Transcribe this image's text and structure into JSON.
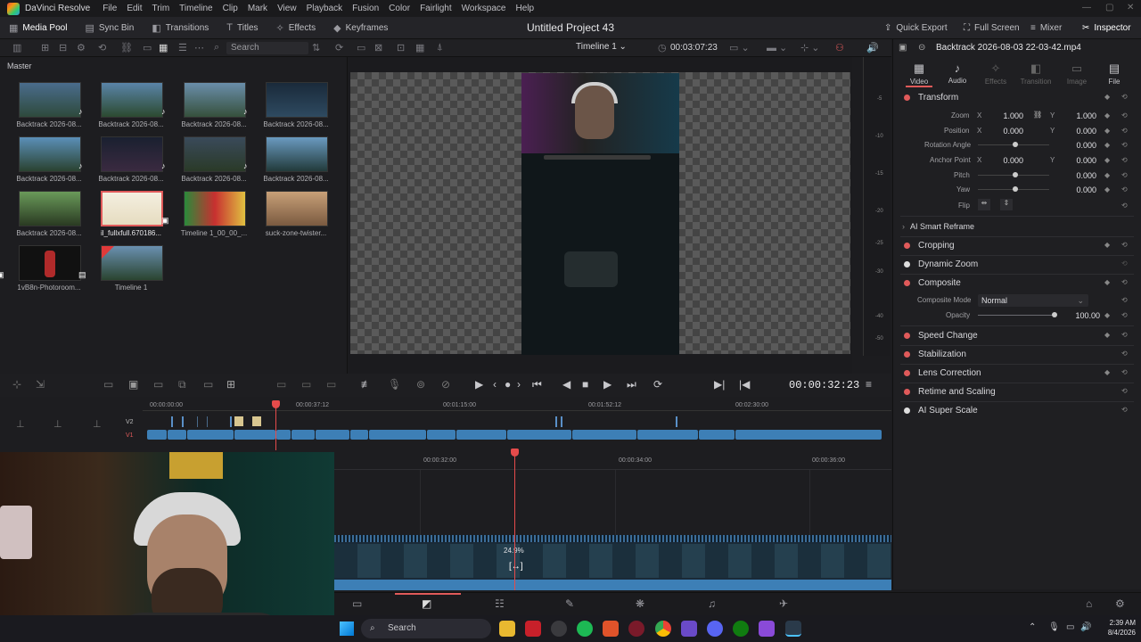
{
  "menubar": {
    "app": "DaVinci Resolve",
    "items": [
      "File",
      "Edit",
      "Trim",
      "Timeline",
      "Clip",
      "Mark",
      "View",
      "Playback",
      "Fusion",
      "Color",
      "Fairlight",
      "Workspace",
      "Help"
    ]
  },
  "toolbar": {
    "media_pool": "Media Pool",
    "sync_bin": "Sync Bin",
    "transitions": "Transitions",
    "titles": "Titles",
    "effects": "Effects",
    "keyframes": "Keyframes",
    "project_title": "Untitled Project 43",
    "quick_export": "Quick Export",
    "full_screen": "Full Screen",
    "mixer": "Mixer",
    "inspector": "Inspector"
  },
  "subbar": {
    "search_placeholder": "Search",
    "timeline_name": "Timeline 1",
    "timecode": "00:03:07:23"
  },
  "media_pool": {
    "bin": "Master",
    "clips": [
      {
        "label": "Backtrack 2026-08...",
        "badge": "♪"
      },
      {
        "label": "Backtrack 2026-08...",
        "badge": "♪"
      },
      {
        "label": "Backtrack 2026-08...",
        "badge": "♪"
      },
      {
        "label": "Backtrack 2026-08...",
        "badge": "♪"
      },
      {
        "label": "Backtrack 2026-08...",
        "badge": "♪"
      },
      {
        "label": "Backtrack 2026-08...",
        "badge": "♪"
      },
      {
        "label": "Backtrack 2026-08...",
        "badge": "♪"
      },
      {
        "label": "Backtrack 2026-08...",
        "badge": "♪"
      },
      {
        "label": "Backtrack 2026-08...",
        "badge": "♪"
      },
      {
        "label": "il_fullxfull.670186...",
        "badge": ""
      },
      {
        "label": "Timeline 1_00_00_...",
        "badge": "▣"
      },
      {
        "label": "suck-zone-twister...",
        "badge": ""
      },
      {
        "label": "1vB8n-Photoroom...",
        "badge": "▣"
      },
      {
        "label": "Timeline 1",
        "badge": "▤"
      }
    ]
  },
  "viewer": {
    "meter_ticks": [
      "-5",
      "-10",
      "-15",
      "-20",
      "-25",
      "-30",
      "-40",
      "-50"
    ]
  },
  "transport": {
    "timecode": "00:00:32:23"
  },
  "inspector": {
    "file": "Backtrack 2026-08-03 22-03-42.mp4",
    "tabs": [
      "Video",
      "Audio",
      "Effects",
      "Transition",
      "Image",
      "File"
    ],
    "transform": "Transform",
    "zoom_label": "Zoom",
    "zoom_x": "1.000",
    "zoom_y": "1.000",
    "position_label": "Position",
    "position_x": "0.000",
    "position_y": "0.000",
    "rotation_label": "Rotation Angle",
    "rotation": "0.000",
    "anchor_label": "Anchor Point",
    "anchor_x": "0.000",
    "anchor_y": "0.000",
    "pitch_label": "Pitch",
    "pitch": "0.000",
    "yaw_label": "Yaw",
    "yaw": "0.000",
    "flip_label": "Flip",
    "x": "X",
    "y": "Y",
    "smart_reframe": "AI Smart Reframe",
    "cropping": "Cropping",
    "dynamic_zoom": "Dynamic Zoom",
    "composite": "Composite",
    "composite_mode_label": "Composite Mode",
    "composite_mode": "Normal",
    "opacity_label": "Opacity",
    "opacity": "100.00",
    "speed_change": "Speed Change",
    "stabilization": "Stabilization",
    "lens_correction": "Lens Correction",
    "retime": "Retime and Scaling",
    "super_scale": "AI Super Scale"
  },
  "timeline": {
    "ruler": [
      "00:00:00:00",
      "00:00:37:12",
      "00:01:15:00",
      "00:01:52:12",
      "00:02:30:00"
    ],
    "v2": "V2",
    "v1": "V1"
  },
  "zoom_timeline": {
    "ruler": [
      "00:00:32:00",
      "00:00:34:00",
      "00:00:36:00"
    ],
    "percent": "24.9%"
  },
  "taskbar": {
    "search": "Search",
    "time": "2:39 AM",
    "date": "8/4/2026"
  }
}
